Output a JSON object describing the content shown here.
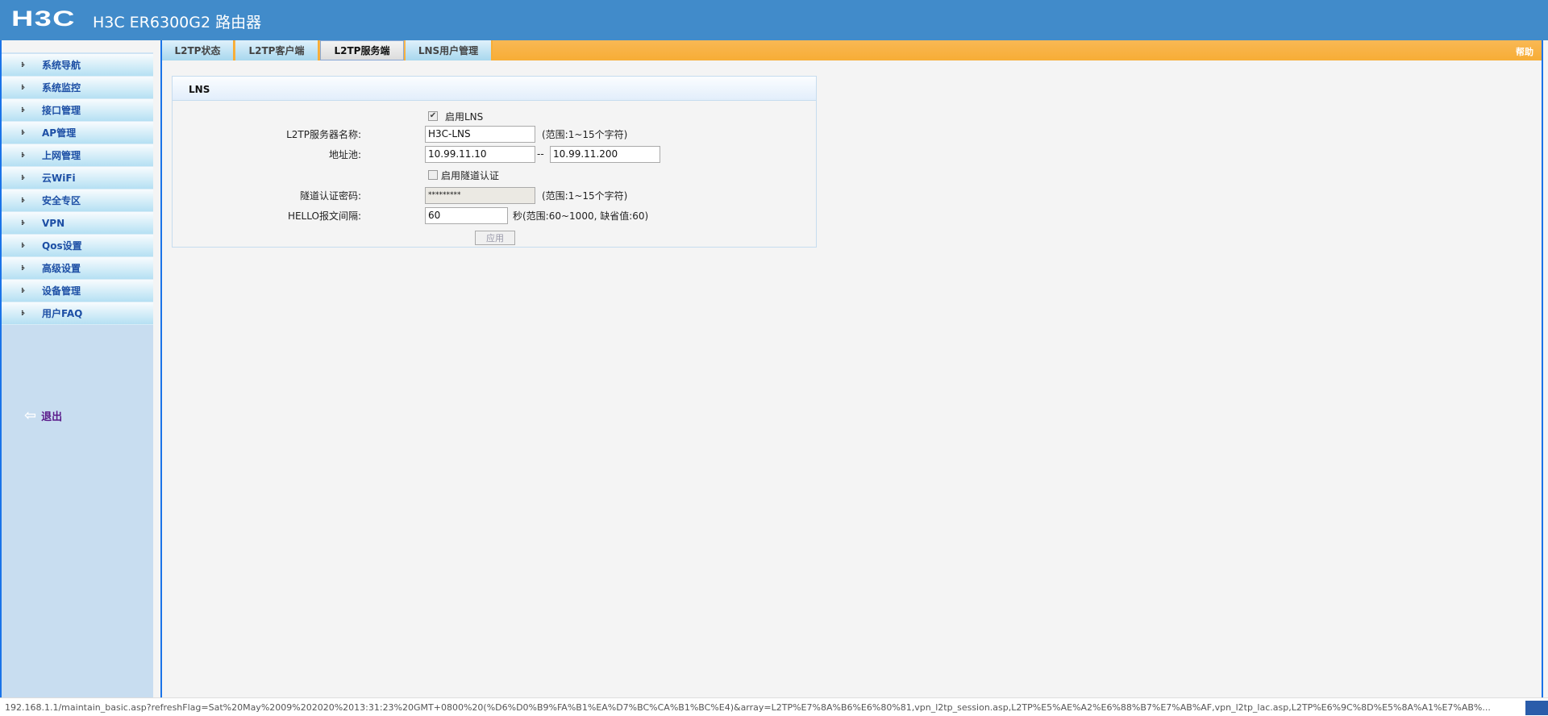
{
  "header": {
    "logo": "H3C",
    "title": "H3C ER6300G2 路由器"
  },
  "sidebar": {
    "items": [
      {
        "label": "系统导航"
      },
      {
        "label": "系统监控"
      },
      {
        "label": "接口管理"
      },
      {
        "label": "AP管理"
      },
      {
        "label": "上网管理"
      },
      {
        "label": "云WiFi"
      },
      {
        "label": "安全专区"
      },
      {
        "label": "VPN"
      },
      {
        "label": "Qos设置"
      },
      {
        "label": "高级设置"
      },
      {
        "label": "设备管理"
      },
      {
        "label": "用户FAQ"
      }
    ],
    "logout": "退出"
  },
  "tabs": [
    {
      "label": "L2TP状态"
    },
    {
      "label": "L2TP客户端"
    },
    {
      "label": "L2TP服务端",
      "active": true
    },
    {
      "label": "LNS用户管理"
    }
  ],
  "help": "帮助",
  "panel": {
    "title": "LNS",
    "enable_lns": {
      "label": "启用LNS",
      "checked": true
    },
    "server_name": {
      "label": "L2TP服务器名称:",
      "value": "H3C-LNS",
      "note": "(范围:1~15个字符)"
    },
    "pool": {
      "label": "地址池:",
      "start": "10.99.11.10",
      "sep": "--",
      "end": "10.99.11.200"
    },
    "tunnel_auth": {
      "label": "启用隧道认证",
      "checked": false
    },
    "tunnel_pwd": {
      "label": "隧道认证密码:",
      "value": "*********",
      "note": "(范围:1~15个字符)"
    },
    "hello": {
      "label": "HELLO报文间隔:",
      "value": "60",
      "note": "秒(范围:60~1000, 缺省值:60)"
    },
    "apply": "应用"
  },
  "status_bar": "192.168.1.1/maintain_basic.asp?refreshFlag=Sat%20May%2009%202020%2013:31:23%20GMT+0800%20(%D6%D0%B9%FA%B1%EA%D7%BC%CA%B1%BC%E4)&array=L2TP%E7%8A%B6%E6%80%81,vpn_l2tp_session.asp,L2TP%E5%AE%A2%E6%88%B7%E7%AB%AF,vpn_l2tp_lac.asp,L2TP%E6%9C%8D%E5%8A%A1%E7%AB%..."
}
